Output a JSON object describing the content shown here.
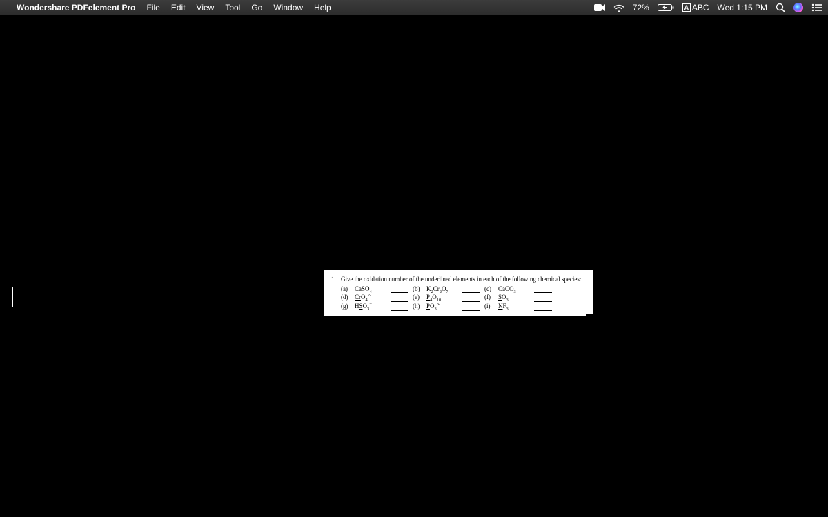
{
  "menubar": {
    "app_name": "Wondershare PDFelement Pro",
    "menus": [
      "File",
      "Edit",
      "View",
      "Tool",
      "Go",
      "Window",
      "Help"
    ],
    "battery_pct": "72%",
    "input_source": "ABC",
    "clock": "Wed 1:15 PM"
  },
  "document": {
    "question_number": "1.",
    "prompt": "Give the oxidation number of the underlined elements in each of the following chemical species:",
    "items": [
      {
        "label": "(a)",
        "before": "Ca",
        "u": "S",
        "sub_after": "O",
        "sub": "4",
        "sup": ""
      },
      {
        "label": "(b)",
        "before": "K",
        "presub": "2",
        "u": "Cr",
        "midsub": "2",
        "after": "O",
        "sub": "7",
        "sup": ""
      },
      {
        "label": "(c)",
        "before": "Ca",
        "u": "C",
        "sub_after": "O",
        "sub": "3",
        "sup": ""
      },
      {
        "label": "(d)",
        "before": "",
        "u": "Cr",
        "sub_after": "O",
        "sub": "4",
        "sup": "2-"
      },
      {
        "label": "(e)",
        "before": "",
        "u": "P",
        "midsub": "4",
        "after": "O",
        "sub": "10",
        "sup": ""
      },
      {
        "label": "(f)",
        "before": "",
        "u": "S",
        "sub_after": "O",
        "sub": "3",
        "sup": ""
      },
      {
        "label": "(g)",
        "before": "H",
        "u": "S",
        "sub_after": "O",
        "sub": "3",
        "sup": "−"
      },
      {
        "label": "(h)",
        "before": "",
        "u": "P",
        "sub_after": "O",
        "sub": "3",
        "sup": "3-"
      },
      {
        "label": "(i)",
        "before": "",
        "u": "N",
        "sub_after": "F",
        "sub": "3",
        "sup": ""
      }
    ]
  }
}
